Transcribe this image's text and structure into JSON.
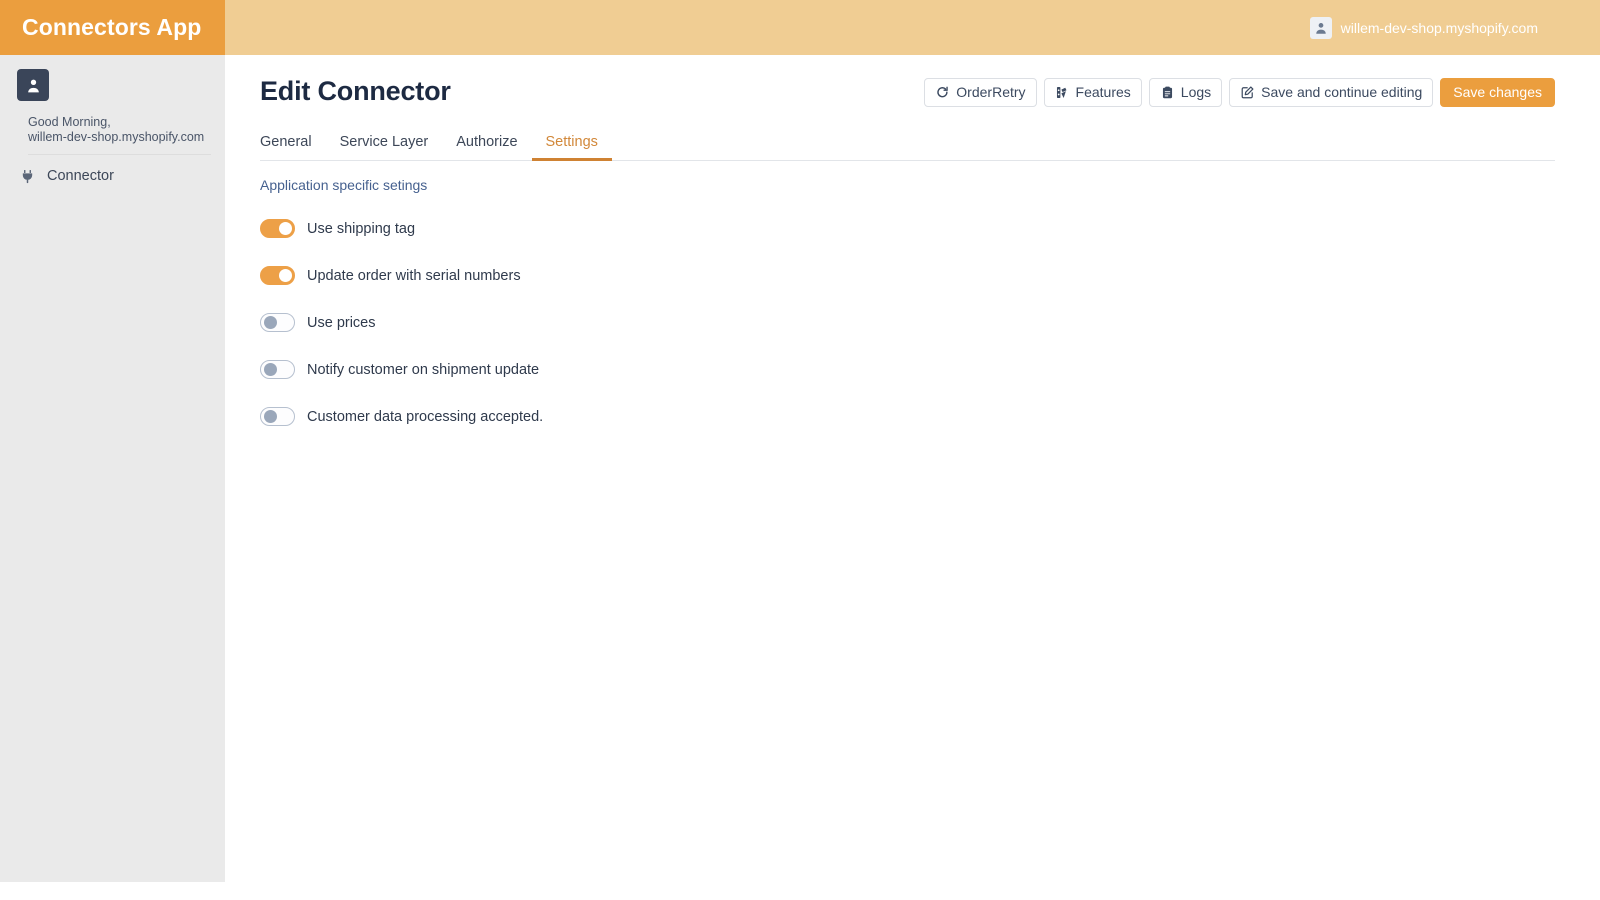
{
  "topbar": {
    "brand_title": "Connectors App",
    "account_name": "willem-dev-shop.myshopify.com",
    "avatar_icon": "user-icon",
    "brand_color": "#eb9e3e",
    "bar_color": "#f0cd93"
  },
  "sidebar": {
    "avatar_icon": "user-avatar-icon",
    "greeting_line1": "Good Morning,",
    "greeting_line2": "willem-dev-shop.myshopify.com",
    "items": [
      {
        "label": "Connector",
        "icon": "plug-icon"
      }
    ]
  },
  "main": {
    "page_title": "Edit Connector",
    "toolbar": [
      {
        "label": "OrderRetry",
        "icon": "refresh-icon",
        "primary": false
      },
      {
        "label": "Features",
        "icon": "sliders-icon",
        "primary": false
      },
      {
        "label": "Logs",
        "icon": "clipboard-icon",
        "primary": false
      },
      {
        "label": "Save and continue editing",
        "icon": "pencil-square-icon",
        "primary": false
      },
      {
        "label": "Save changes",
        "icon": "",
        "primary": true
      }
    ],
    "tabs": [
      {
        "label": "General",
        "active": false
      },
      {
        "label": "Service Layer",
        "active": false
      },
      {
        "label": "Authorize",
        "active": false
      },
      {
        "label": "Settings",
        "active": true
      }
    ],
    "settings": {
      "section_label": "Application specific setings",
      "accent_on_color": "#eda047",
      "toggles": [
        {
          "label": "Use shipping tag",
          "on": true
        },
        {
          "label": "Update order with serial numbers",
          "on": true
        },
        {
          "label": "Use prices",
          "on": false
        },
        {
          "label": "Notify customer on shipment update",
          "on": false
        },
        {
          "label": "Customer data processing accepted.",
          "on": false
        }
      ]
    }
  }
}
